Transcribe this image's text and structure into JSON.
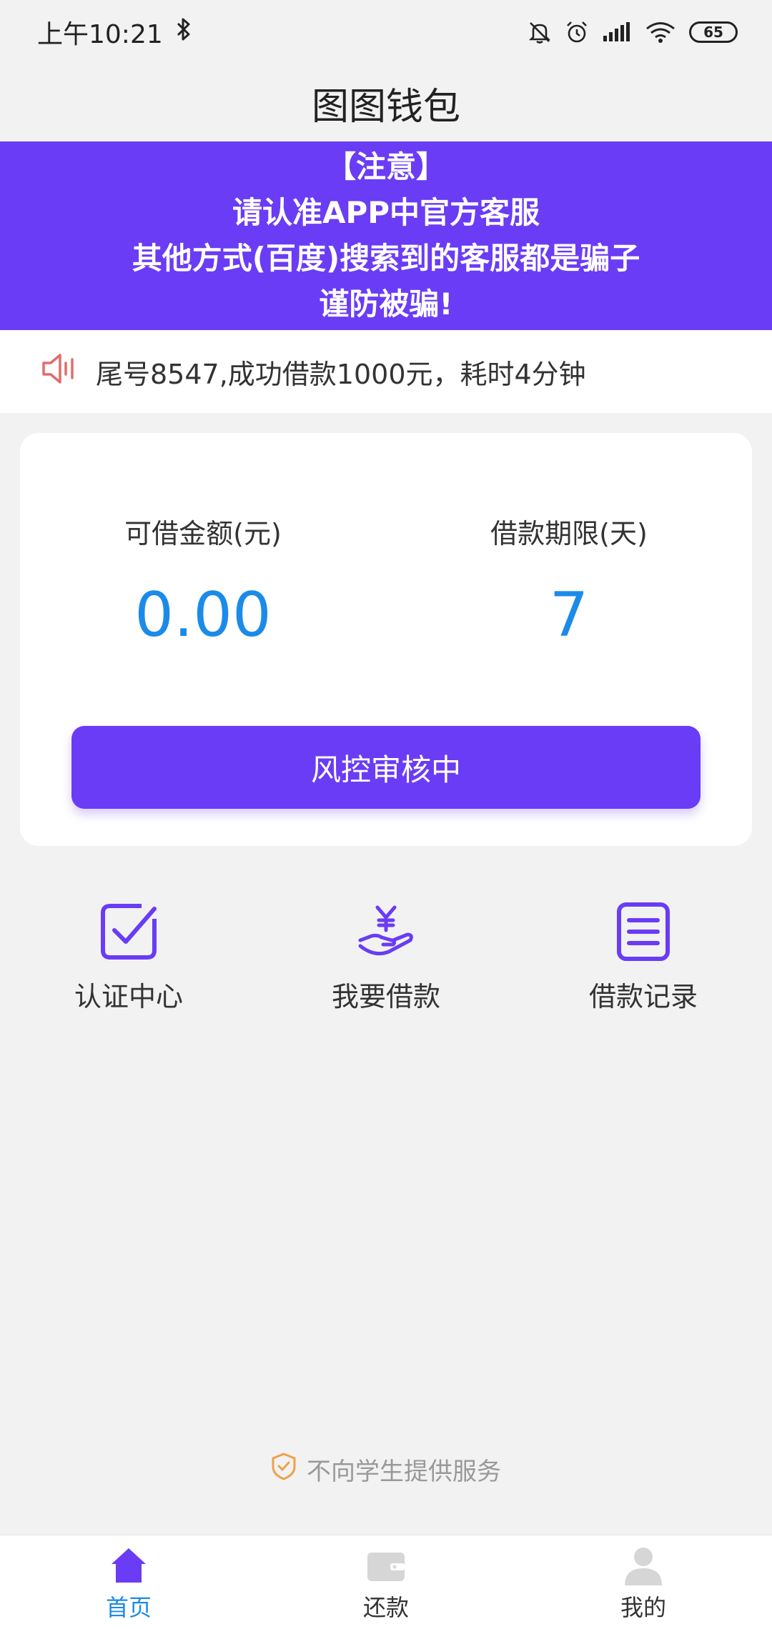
{
  "status_bar": {
    "time": "上午10:21",
    "battery": "65",
    "icons": [
      "bluetooth-icon",
      "bell-off-icon",
      "alarm-icon",
      "signal-icon",
      "wifi-icon",
      "battery-icon"
    ]
  },
  "header": {
    "title": "图图钱包"
  },
  "notice": {
    "line1": "【注意】",
    "line2": "请认准APP中官方客服",
    "line3": "其他方式(百度)搜索到的客服都是骗子",
    "line4": "谨防被骗!"
  },
  "marquee": {
    "text": "尾号8547,成功借款1000元，耗时4分钟",
    "icon": "speaker-icon"
  },
  "loan_card": {
    "amount_label": "可借金额(元)",
    "amount_value": "0.00",
    "term_label": "借款期限(天)",
    "term_value": "7",
    "button_label": "风控审核中"
  },
  "quick_actions": [
    {
      "label": "认证中心",
      "icon": "checkbox-icon"
    },
    {
      "label": "我要借款",
      "icon": "yen-hand-icon"
    },
    {
      "label": "借款记录",
      "icon": "list-document-icon"
    }
  ],
  "footer_note": {
    "text": "不向学生提供服务",
    "icon": "shield-check-icon"
  },
  "bottom_nav": [
    {
      "label": "首页",
      "icon": "home-icon",
      "active": true
    },
    {
      "label": "还款",
      "icon": "wallet-icon",
      "active": false
    },
    {
      "label": "我的",
      "icon": "user-icon",
      "active": false
    }
  ],
  "colors": {
    "accent": "#6a3cf5",
    "value_blue": "#1b8be8",
    "background": "#f2f2f2",
    "speaker": "#e36b6b",
    "footer_icon": "#f0a04b"
  }
}
